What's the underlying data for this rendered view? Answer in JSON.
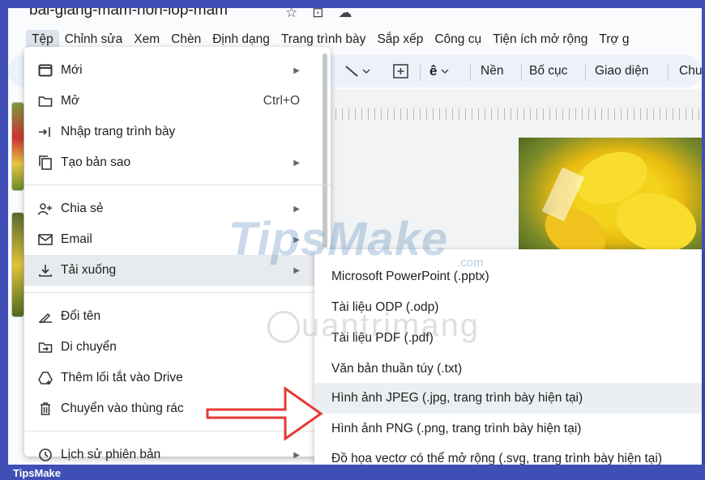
{
  "doc": {
    "title": "bai-giang-mam-non-lop-mam",
    "star_icon": "star-icon",
    "move_icon": "move-to-folder-icon",
    "cloud_icon": "cloud-saved-icon"
  },
  "menubar": {
    "items": [
      "Tệp",
      "Chỉnh sửa",
      "Xem",
      "Chèn",
      "Định dạng",
      "Trang trình bày",
      "Sắp xếp",
      "Công cụ",
      "Tiện ích mở rộng",
      "Trợ g"
    ],
    "active_index": 0
  },
  "toolbar": {
    "background": "Nền",
    "layout": "Bố cục",
    "theme": "Giao diện",
    "transition": "Chu"
  },
  "file_menu": {
    "items": [
      {
        "icon": "new-slide-icon",
        "label": "Mới",
        "has_submenu": true
      },
      {
        "icon": "folder-icon",
        "label": "Mở",
        "shortcut": "Ctrl+O"
      },
      {
        "icon": "import-slides-icon",
        "label": "Nhập trang trình bày"
      },
      {
        "icon": "copy-icon",
        "label": "Tạo bản sao",
        "has_submenu": true
      },
      {
        "icon": "share-icon",
        "label": "Chia sẻ",
        "has_submenu": true
      },
      {
        "icon": "email-icon",
        "label": "Email",
        "has_submenu": true
      },
      {
        "icon": "download-icon",
        "label": "Tải xuống",
        "has_submenu": true,
        "highlighted": true
      },
      {
        "icon": "rename-icon",
        "label": "Đổi tên"
      },
      {
        "icon": "move-icon",
        "label": "Di chuyển"
      },
      {
        "icon": "add-shortcut-icon",
        "label": "Thêm lối tắt vào Drive"
      },
      {
        "icon": "trash-icon",
        "label": "Chuyển vào thùng rác"
      },
      {
        "icon": "version-history-icon",
        "label": "Lịch sử phiên bản",
        "has_submenu": true
      }
    ]
  },
  "download_submenu": {
    "items": [
      {
        "label": "Microsoft PowerPoint (.pptx)"
      },
      {
        "label": "Tài liệu ODP (.odp)"
      },
      {
        "label": "Tài liệu PDF (.pdf)"
      },
      {
        "label": "Văn bản thuần túy (.txt)"
      },
      {
        "label": "Hình ảnh JPEG (.jpg, trang trình bày hiện tại)",
        "highlighted": true
      },
      {
        "label": "Hình ảnh PNG (.png, trang trình bày hiện tại)"
      },
      {
        "label": "Đồ họa vectơ có thể mở rộng (.svg, trang trình bày hiện tại)"
      }
    ]
  },
  "watermark": {
    "primary": "TipsMake",
    "primary_suffix": ".com",
    "secondary": "uantrimang"
  },
  "footer": {
    "brand": "TipsMake"
  },
  "colors": {
    "frame": "#3f4fb5",
    "highlight": "#e8ebee",
    "annotation_arrow": "#e53935"
  }
}
